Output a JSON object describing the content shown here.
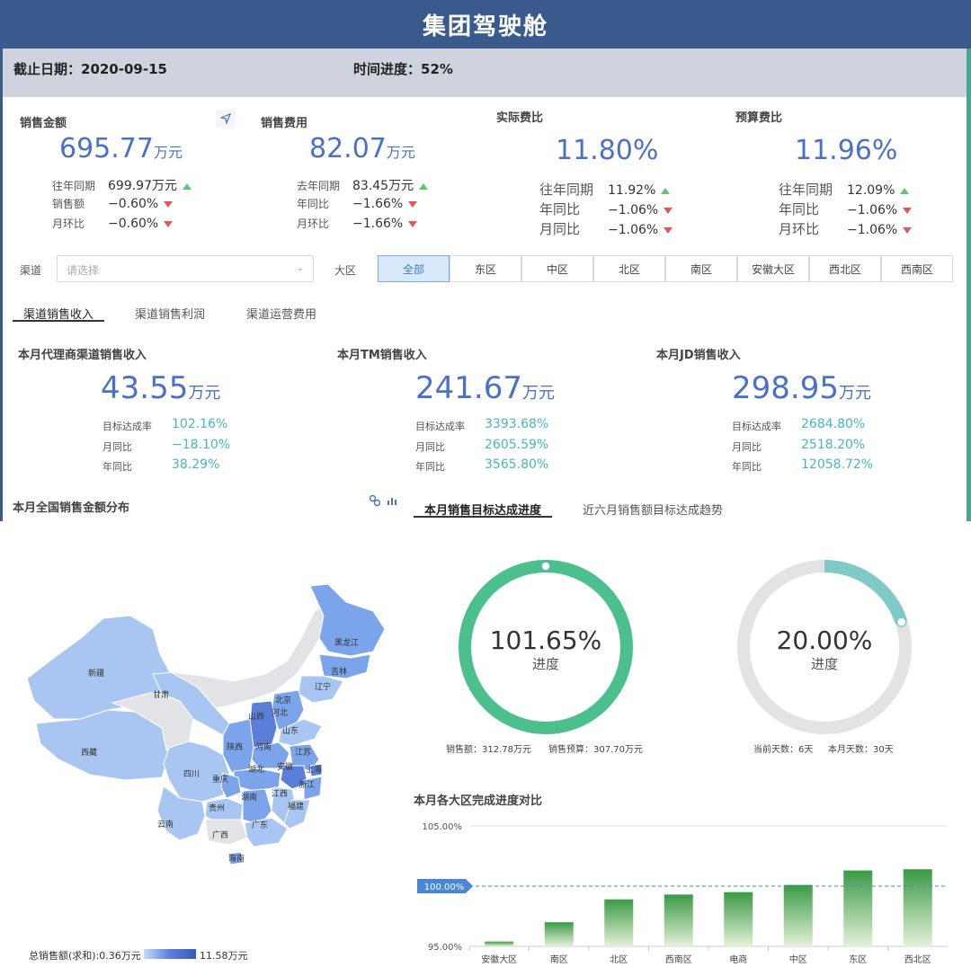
{
  "header": {
    "title": "集团驾驶舱"
  },
  "info": {
    "cutoff": "截止日期：2020-09-15",
    "progress": "时间进度：52%"
  },
  "kpis": [
    {
      "label": "销售金额",
      "value": "695.77",
      "unit": "万元",
      "rows": [
        {
          "k": "往年同期",
          "v": "699.97万元",
          "trend": "up"
        },
        {
          "k": "销售额",
          "v": "−0.60%",
          "trend": "down"
        },
        {
          "k": "月环比",
          "v": "−0.60%",
          "trend": "down"
        }
      ]
    },
    {
      "label": "销售费用",
      "value": "82.07",
      "unit": "万元",
      "rows": [
        {
          "k": "去年同期",
          "v": "83.45万元",
          "trend": "up"
        },
        {
          "k": "年同比",
          "v": "−1.66%",
          "trend": "down"
        },
        {
          "k": "月环比",
          "v": "−1.66%",
          "trend": "down"
        }
      ]
    },
    {
      "label": "实际费比",
      "value": "11.80%",
      "unit": "",
      "rows": [
        {
          "k": "往年同期",
          "v": "11.92%",
          "trend": "up"
        },
        {
          "k": "年同比",
          "v": "−1.06%",
          "trend": "down"
        },
        {
          "k": "月同比",
          "v": "−1.06%",
          "trend": "down"
        }
      ]
    },
    {
      "label": "预算费比",
      "value": "11.96%",
      "unit": "",
      "rows": [
        {
          "k": "往年同期",
          "v": "12.09%",
          "trend": "up"
        },
        {
          "k": "年同比",
          "v": "−1.06%",
          "trend": "down"
        },
        {
          "k": "月环比",
          "v": "−1.06%",
          "trend": "down"
        }
      ]
    }
  ],
  "filters": {
    "channel_label": "渠道",
    "channel_placeholder": "请选择",
    "region_label": "大区",
    "regions": [
      "全部",
      "东区",
      "中区",
      "北区",
      "南区",
      "安徽大区",
      "西北区",
      "西南区"
    ],
    "active_region": "全部"
  },
  "tabs": [
    "渠道销售收入",
    "渠道销售利润",
    "渠道运营费用"
  ],
  "channels": [
    {
      "label": "本月代理商渠道销售收入",
      "value": "43.55",
      "unit": "万元",
      "rows": [
        {
          "k": "目标达成率",
          "v": "102.16%"
        },
        {
          "k": "月同比",
          "v": "−18.10%"
        },
        {
          "k": "年同比",
          "v": "38.29%"
        }
      ]
    },
    {
      "label": "本月TM销售收入",
      "value": "241.67",
      "unit": "万元",
      "rows": [
        {
          "k": "目标达成率",
          "v": "3393.68%"
        },
        {
          "k": "月同比",
          "v": "2605.59%"
        },
        {
          "k": "年同比",
          "v": "3565.80%"
        }
      ]
    },
    {
      "label": "本月JD销售收入",
      "value": "298.95",
      "unit": "万元",
      "rows": [
        {
          "k": "目标达成率",
          "v": "2684.80%"
        },
        {
          "k": "月同比",
          "v": "2518.20%"
        },
        {
          "k": "年同比",
          "v": "12058.72%"
        }
      ]
    }
  ],
  "map": {
    "title": "本月全国销售金额分布",
    "legend_min": "总销售额(求和):0.36万元",
    "legend_max": "11.58万元",
    "provinces": [
      "新疆",
      "西藏",
      "甘肃",
      "黑龙江",
      "吉林",
      "辽宁",
      "北京",
      "河北",
      "山西",
      "山东",
      "陕西",
      "河南",
      "江苏",
      "四川",
      "重庆",
      "湖北",
      "安徽",
      "上海",
      "浙江",
      "贵州",
      "湖南",
      "江西",
      "云南",
      "广西",
      "广东",
      "福建",
      "海南"
    ],
    "colors": {
      "light": "#a9c6f2",
      "mid": "#7ba4ea",
      "dark": "#5b7fd9",
      "gray": "#e1e3e6"
    }
  },
  "progress_tabs": [
    "本月销售目标达成进度",
    "近六月销售额目标达成趋势"
  ],
  "gauges": [
    {
      "value_text": "101.65%",
      "value": 101.65,
      "sub": "进度",
      "foot": [
        "销售额：312.78万元",
        "销售预算：307.70万元"
      ],
      "color": "#4cbf8f"
    },
    {
      "value_text": "20.00%",
      "value": 20.0,
      "sub": "进度",
      "foot": [
        "当前天数：6天",
        "本月天数：30天"
      ],
      "color": "#7dcbc4"
    }
  ],
  "chart_data": {
    "type": "bar",
    "title": "本月各大区完成进度对比",
    "categories": [
      "安徽大区",
      "南区",
      "北区",
      "西南区",
      "电商",
      "中区",
      "东区",
      "西北区"
    ],
    "values": [
      95.4,
      97.0,
      98.9,
      99.3,
      99.5,
      100.1,
      101.3,
      101.4
    ],
    "ylim": [
      95,
      105
    ],
    "yticks": [
      "105.00%",
      "95.00%"
    ],
    "reference": {
      "value": 100,
      "label": "100.00%"
    },
    "colors": {
      "bar_top": "#3a9a45",
      "bar_bottom": "#e4f1d8",
      "ref": "#4a86d6"
    }
  }
}
